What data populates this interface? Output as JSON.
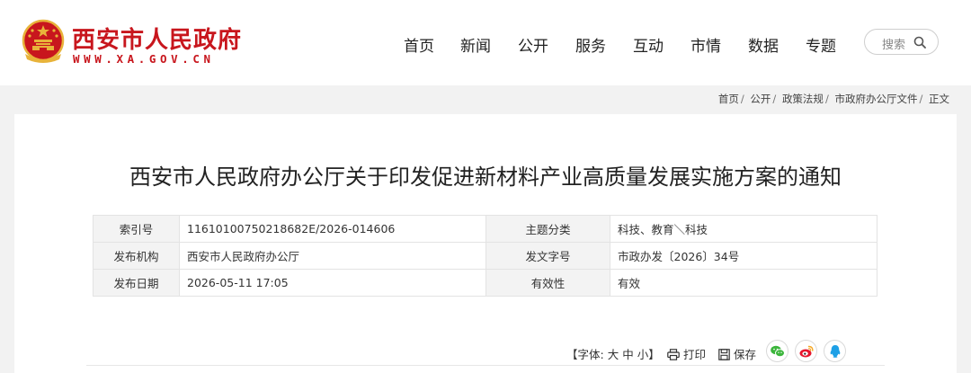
{
  "brand": {
    "name": "西安市人民政府",
    "url": "WWW.XA.GOV.CN",
    "colors": {
      "primary": "#c8161d",
      "emblem_gold": "#e8b33a"
    }
  },
  "nav": {
    "items": [
      "首页",
      "新闻",
      "公开",
      "服务",
      "互动",
      "市情",
      "数据",
      "专题"
    ]
  },
  "search": {
    "placeholder": "搜索",
    "icon": "search-icon"
  },
  "breadcrumb": [
    "首页",
    "公开",
    "政策法规",
    "市政府办公厅文件",
    "正文"
  ],
  "document": {
    "title": "西安市人民政府办公厅关于印发促进新材料产业高质量发展实施方案的通知",
    "meta": {
      "index_label": "索引号",
      "index_value": "11610100750218682E/2026-014606",
      "topic_label": "主题分类",
      "topic_value": "科技、教育＼科技",
      "publisher_label": "发布机构",
      "publisher_value": "西安市人民政府办公厅",
      "doc_no_label": "发文字号",
      "doc_no_value": "市政办发〔2026〕34号",
      "date_label": "发布日期",
      "date_value": "2026-05-11 17:05",
      "validity_label": "有效性",
      "validity_value": "有效"
    }
  },
  "toolbar": {
    "font_prefix": "【字体:",
    "font_large": "大",
    "font_medium": "中",
    "font_small": "小",
    "font_suffix": "】",
    "print_label": "打印",
    "save_label": "保存",
    "share_icons": [
      "wechat-icon",
      "weibo-icon",
      "qq-icon"
    ]
  }
}
